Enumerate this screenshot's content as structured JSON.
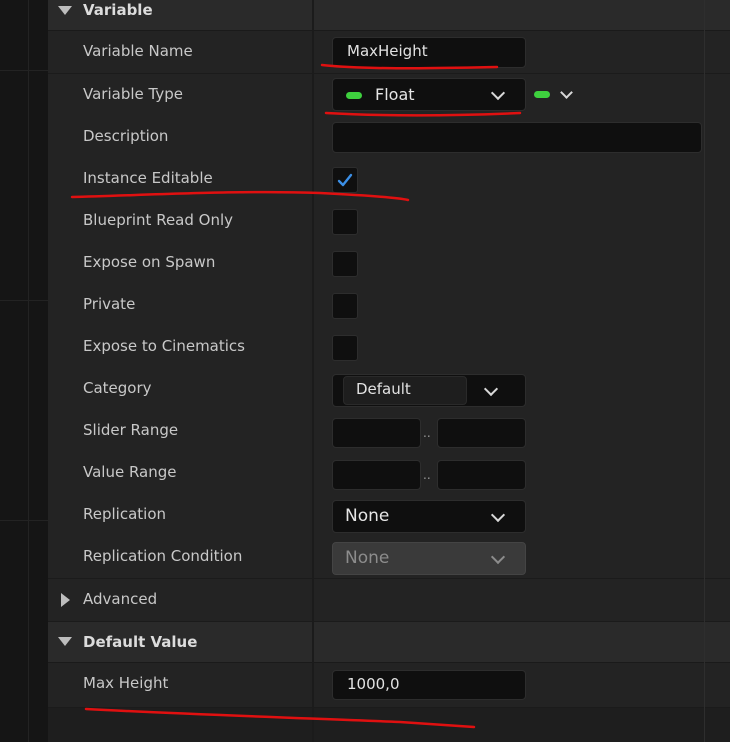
{
  "sections": {
    "variable": {
      "title": "Variable",
      "rows": {
        "name": {
          "label": "Variable Name",
          "value": "MaxHeight"
        },
        "type": {
          "label": "Variable Type",
          "value": "Float"
        },
        "description": {
          "label": "Description",
          "value": ""
        },
        "instance_editable": {
          "label": "Instance Editable",
          "checked": true
        },
        "blueprint_read_only": {
          "label": "Blueprint Read Only",
          "checked": false
        },
        "expose_on_spawn": {
          "label": "Expose on Spawn",
          "checked": false
        },
        "private": {
          "label": "Private",
          "checked": false
        },
        "expose_to_cinematics": {
          "label": "Expose to Cinematics",
          "checked": false
        },
        "category": {
          "label": "Category",
          "value": "Default"
        },
        "slider_range": {
          "label": "Slider Range",
          "min": "",
          "max": "",
          "separator": ".."
        },
        "value_range": {
          "label": "Value Range",
          "min": "",
          "max": "",
          "separator": ".."
        },
        "replication": {
          "label": "Replication",
          "value": "None"
        },
        "replication_condition": {
          "label": "Replication Condition",
          "value": "None"
        }
      }
    },
    "advanced": {
      "title": "Advanced"
    },
    "default_value": {
      "title": "Default Value",
      "rows": {
        "max_height": {
          "label": "Max Height",
          "value": "1000,0"
        }
      }
    }
  },
  "colors": {
    "type_pill": "#3ed03e",
    "checkmark": "#3b8fe6",
    "annotation": "#e01010"
  },
  "icons": {
    "collapse": "triangle-down",
    "expand": "triangle-right",
    "dropdown": "chevron-down",
    "check": "checkmark"
  }
}
